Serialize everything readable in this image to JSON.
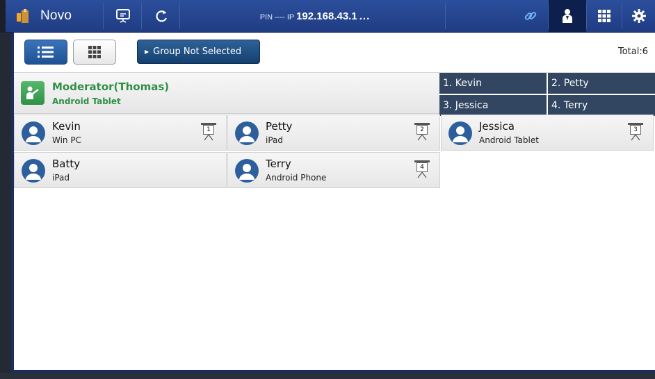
{
  "topbar": {
    "app_title": "Novo",
    "pin_label": "PIN ----",
    "ip_label": "IP",
    "ip_value": "192.168.43.1",
    "more_label": "...",
    "icons": [
      "novo-logo-icon",
      "presentation-icon",
      "refresh-icon",
      "link-icon",
      "users-icon",
      "apps-grid-icon",
      "settings-gear-icon"
    ]
  },
  "toolbar": {
    "group_button_label": "Group Not Selected",
    "total_label": "Total:6"
  },
  "moderator": {
    "name": "Moderator(Thomas)",
    "device": "Android Tablet"
  },
  "queue": [
    {
      "label": "1. Kevin"
    },
    {
      "label": "2. Petty"
    },
    {
      "label": "3. Jessica"
    },
    {
      "label": "4. Terry"
    }
  ],
  "users": [
    {
      "name": "Kevin",
      "device": "Win PC",
      "screen": "1"
    },
    {
      "name": "Petty",
      "device": "iPad",
      "screen": "2"
    },
    {
      "name": "Jessica",
      "device": "Android Tablet",
      "screen": "3"
    },
    {
      "name": "Batty",
      "device": "iPad",
      "screen": ""
    },
    {
      "name": "Terry",
      "device": "Android Phone",
      "screen": "4"
    }
  ],
  "colors": {
    "topbar": "#2c4f9c",
    "moderator_green": "#2f8f46",
    "queue_bg": "#324561",
    "avatar_blue": "#2e5f9d"
  }
}
